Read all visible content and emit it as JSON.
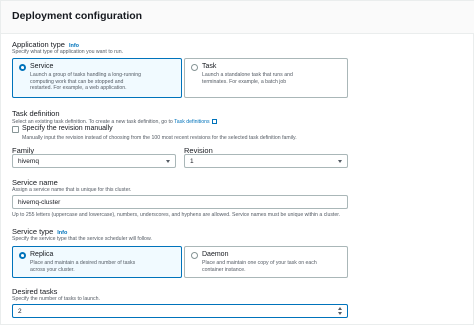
{
  "section": {
    "title": "Deployment configuration"
  },
  "app_type": {
    "label": "Application type",
    "info": "Info",
    "description": "Specify what type of application you want to run.",
    "options": [
      {
        "title": "Service",
        "description": "Launch a group of tasks handling a long-running computing work that can be stopped and restarted. For example, a web application.",
        "selected": true
      },
      {
        "title": "Task",
        "description": "Launch a standalone task that runs and terminates. For example, a batch job",
        "selected": false
      }
    ]
  },
  "task_definition": {
    "label": "Task definition",
    "description_prefix": "Select an existing task definition. To create a new task definition, go to",
    "description_link": "Task definitions",
    "specify_revision_label": "Specify the revision manually",
    "specify_revision_desc": "Manually input the revision instead of choosing from the 100 most recent revisions for the selected task definition family."
  },
  "family": {
    "label": "Family",
    "value": "hivemq"
  },
  "revision": {
    "label": "Revision",
    "value": "1"
  },
  "service_name": {
    "label": "Service name",
    "description": "Assign a service name that is unique for this cluster.",
    "value": "hivemq-cluster",
    "constraint": "Up to 255 letters (uppercase and lowercase), numbers, underscores, and hyphens are allowed. Service names must be unique within a cluster."
  },
  "service_type": {
    "label": "Service type",
    "info": "Info",
    "description": "Specify the service type that the service scheduler will follow.",
    "options": [
      {
        "title": "Replica",
        "description": "Place and maintain a desired number of tasks across your cluster.",
        "selected": true
      },
      {
        "title": "Daemon",
        "description": "Place and maintain one copy of your task on each container instance.",
        "selected": false
      }
    ]
  },
  "desired_tasks": {
    "label": "Desired tasks",
    "description": "Specify the number of tasks to launch.",
    "value": "2"
  }
}
